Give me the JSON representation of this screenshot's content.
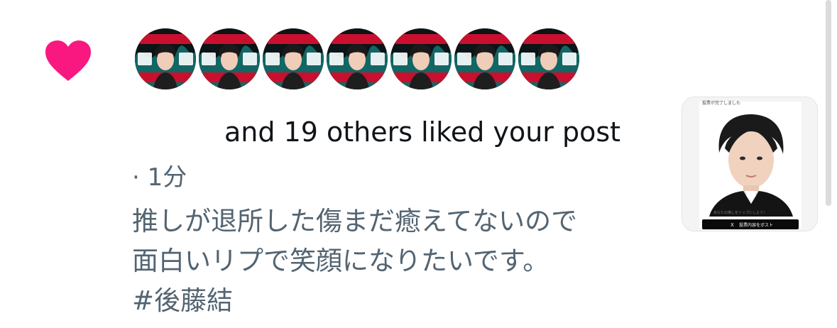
{
  "notification": {
    "type_icon": "heart-icon",
    "like_color": "#f91880",
    "avatars": [
      {
        "name": "avatar-1"
      },
      {
        "name": "avatar-2"
      },
      {
        "name": "avatar-3"
      },
      {
        "name": "avatar-4"
      },
      {
        "name": "avatar-5"
      },
      {
        "name": "avatar-6"
      },
      {
        "name": "avatar-7"
      }
    ],
    "headline": "and 19 others liked your post",
    "time": "· 1分",
    "post_text_line1": "推しが退所した傷まだ癒えてないので",
    "post_text_line2": "面白いリプで笑顔になりたいです。",
    "hashtag": "#後藤結"
  },
  "thumbnail": {
    "caption_top": "投票が完了しました",
    "caption_small": "あなたの推しをトップにしよう！",
    "button_icon": "x-logo-icon",
    "button_label": "投票内容をポスト"
  },
  "colors": {
    "text_primary": "#0f1419",
    "text_secondary": "#536471",
    "avatar_red": "#c8102e",
    "avatar_teal": "#1aa9a6"
  }
}
